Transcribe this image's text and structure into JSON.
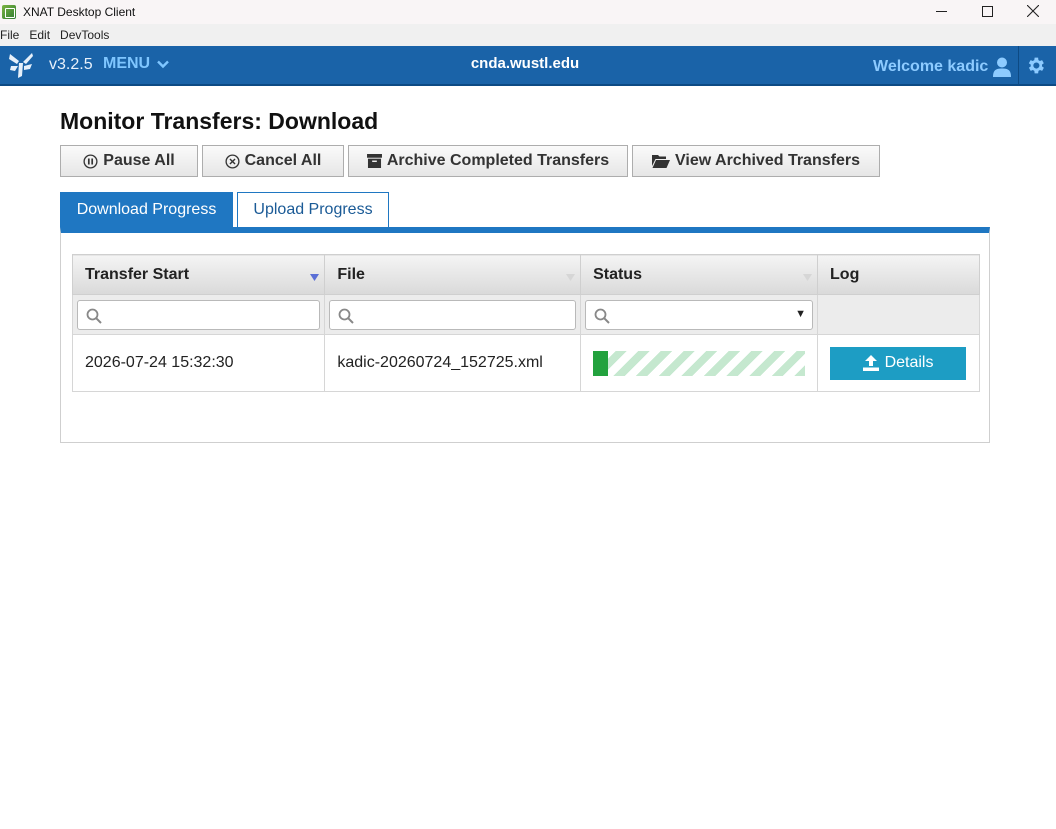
{
  "window": {
    "title": "XNAT Desktop Client"
  },
  "menubar": {
    "items": [
      "File",
      "Edit",
      "DevTools"
    ]
  },
  "header": {
    "version": "v3.2.5",
    "menu_label": "MENU",
    "hostname": "cnda.wustl.edu",
    "welcome": "Welcome kadic"
  },
  "page": {
    "title": "Monitor Transfers: Download"
  },
  "toolbar": {
    "pause_all": "Pause All",
    "cancel_all": "Cancel All",
    "archive_completed": "Archive Completed Transfers",
    "view_archived": "View Archived Transfers"
  },
  "tabs": [
    {
      "label": "Download Progress",
      "active": true
    },
    {
      "label": "Upload Progress",
      "active": false
    }
  ],
  "table": {
    "columns": [
      "Transfer Start",
      "File",
      "Status",
      "Log"
    ],
    "rows": [
      {
        "transfer_start": "2026-07-24 15:32:30",
        "file": "kadic-20260724_152725.xml",
        "progress_percent": 7,
        "log_button": "Details"
      }
    ]
  },
  "colors": {
    "header": "#1a63a8",
    "tab_active": "#1f77c2",
    "progress_fill": "#23a23e",
    "details_button": "#1d9dc4"
  }
}
